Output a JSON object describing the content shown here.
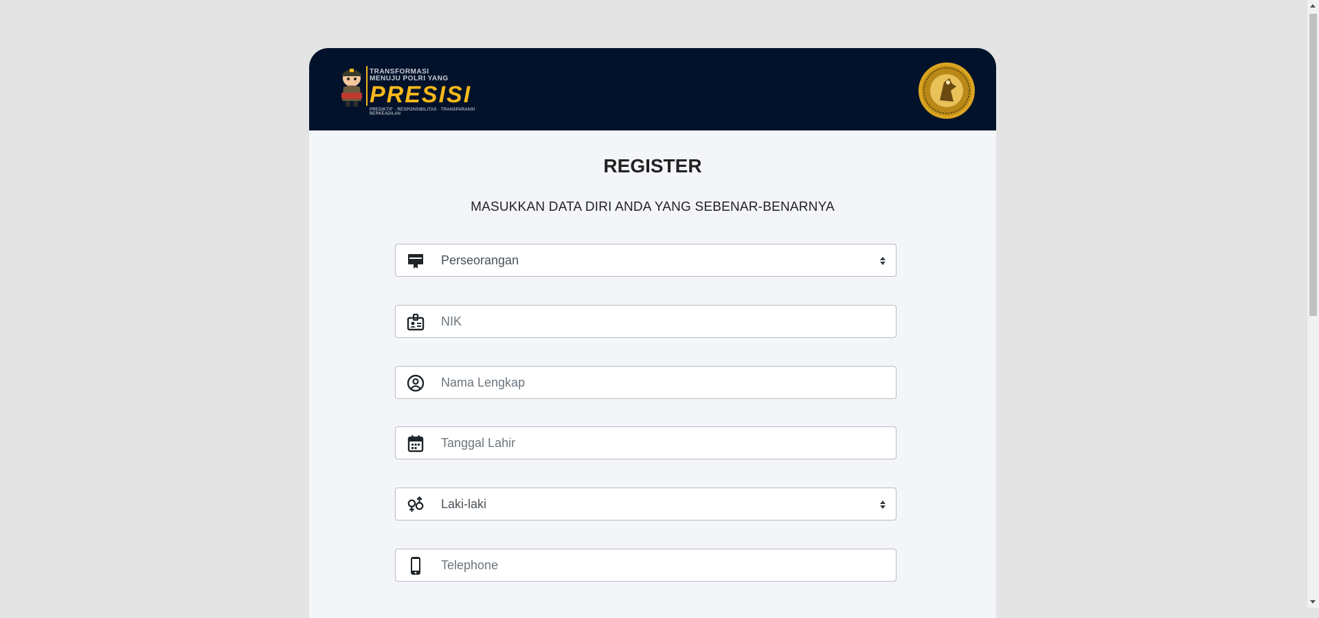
{
  "banner": {
    "logo_line1": "TRANSFORMASI",
    "logo_line2": "MENUJU POLRI YANG",
    "logo_word": "PRESISI",
    "logo_tagline": "PREDIKTIF · RESPONSIBILITAS · TRANSPARANSI BERKEADILAN",
    "seal_icon": "police-seal-icon"
  },
  "page": {
    "title": "REGISTER",
    "subtitle": "MASUKKAN DATA DIRI ANDA YANG SEBENAR-BENARNYA"
  },
  "form": {
    "type": {
      "value": "Perseorangan",
      "icon": "id-card-icon"
    },
    "nik": {
      "placeholder": "NIK",
      "icon": "badge-icon"
    },
    "name": {
      "placeholder": "Nama Lengkap",
      "icon": "user-circle-icon"
    },
    "dob": {
      "placeholder": "Tanggal Lahir",
      "icon": "calendar-icon"
    },
    "gender": {
      "value": "Laki-laki",
      "icon": "gender-icon"
    },
    "phone": {
      "placeholder": "Telephone",
      "icon": "phone-icon"
    }
  },
  "colors": {
    "banner": "#02122b",
    "accent": "#f6b81a",
    "card": "#f3f5f9",
    "background": "#e4e4e4"
  }
}
